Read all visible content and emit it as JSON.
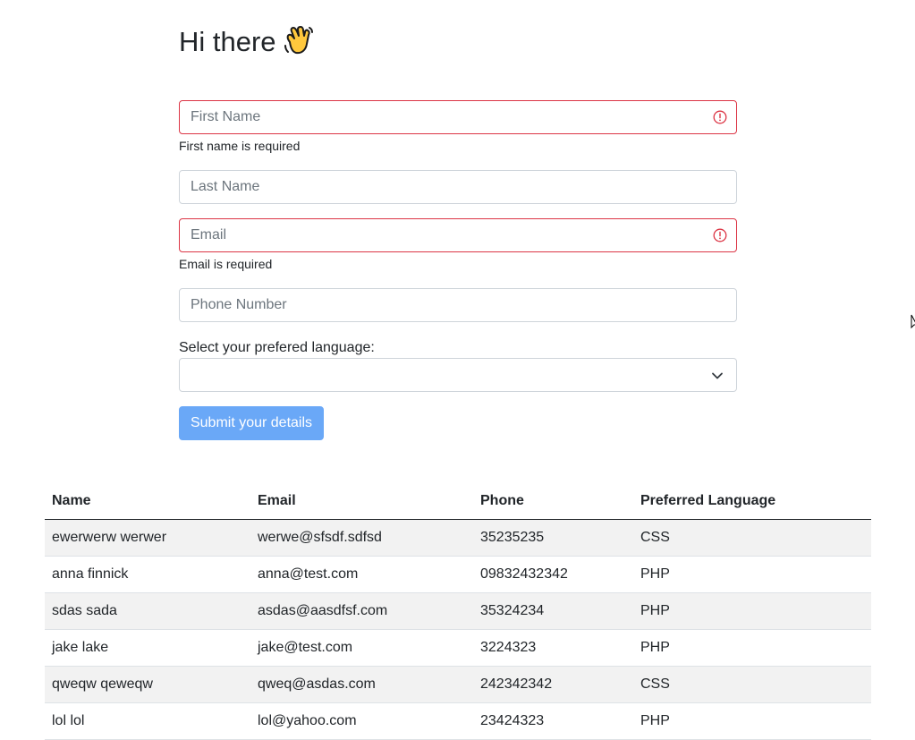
{
  "header": {
    "title": "Hi there",
    "emoji_icon": "waving-hand-icon"
  },
  "form": {
    "first_name": {
      "placeholder": "First Name",
      "value": "",
      "error": "First name is required"
    },
    "last_name": {
      "placeholder": "Last Name",
      "value": ""
    },
    "email": {
      "placeholder": "Email",
      "value": "",
      "error": "Email is required"
    },
    "phone": {
      "placeholder": "Phone Number",
      "value": ""
    },
    "language_label": "Select your prefered language:",
    "language_selected": "",
    "submit_label": "Submit your details"
  },
  "colors": {
    "error": "#dc3545",
    "primary_disabled": "#6aa8f7",
    "stripe": "#f2f2f2"
  },
  "table": {
    "headers": [
      "Name",
      "Email",
      "Phone",
      "Preferred Language"
    ],
    "rows": [
      [
        "ewerwerw werwer",
        "werwe@sfsdf.sdfsd",
        "35235235",
        "CSS"
      ],
      [
        "anna finnick",
        "anna@test.com",
        "09832432342",
        "PHP"
      ],
      [
        "sdas sada",
        "asdas@aasdfsf.com",
        "35324234",
        "PHP"
      ],
      [
        "jake lake",
        "jake@test.com",
        "3224323",
        "PHP"
      ],
      [
        "qweqw qeweqw",
        "qweq@asdas.com",
        "242342342",
        "CSS"
      ],
      [
        "lol lol",
        "lol@yahoo.com",
        "23424323",
        "PHP"
      ]
    ]
  }
}
